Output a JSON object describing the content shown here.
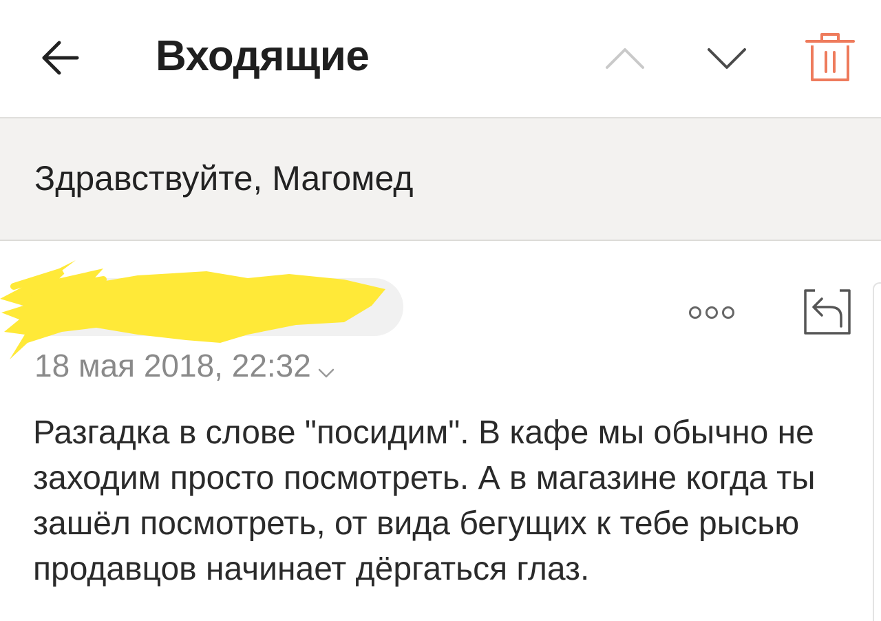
{
  "header": {
    "title": "Входящие",
    "icons": {
      "back": "arrow-left-icon",
      "prev": "chevron-up-icon",
      "next": "chevron-down-icon",
      "delete": "trash-icon"
    }
  },
  "message": {
    "subject": "Здравствуйте, Магомед",
    "sender": "",
    "date": "18 мая 2018, 22:32",
    "body": "Разгадка в слове \"посидим\". В кафе мы обычно не заходим просто посмотреть. А в магазине когда ты зашёл посмотреть, от вида бегущих к тебе рысью продавцов начинает дёргаться глаз.",
    "icons": {
      "more": "more-dots-icon",
      "reply": "reply-icon"
    }
  },
  "colors": {
    "accent_delete": "#ee7b5c",
    "redaction": "#ffe938",
    "subject_bg": "#f3f2f0"
  }
}
